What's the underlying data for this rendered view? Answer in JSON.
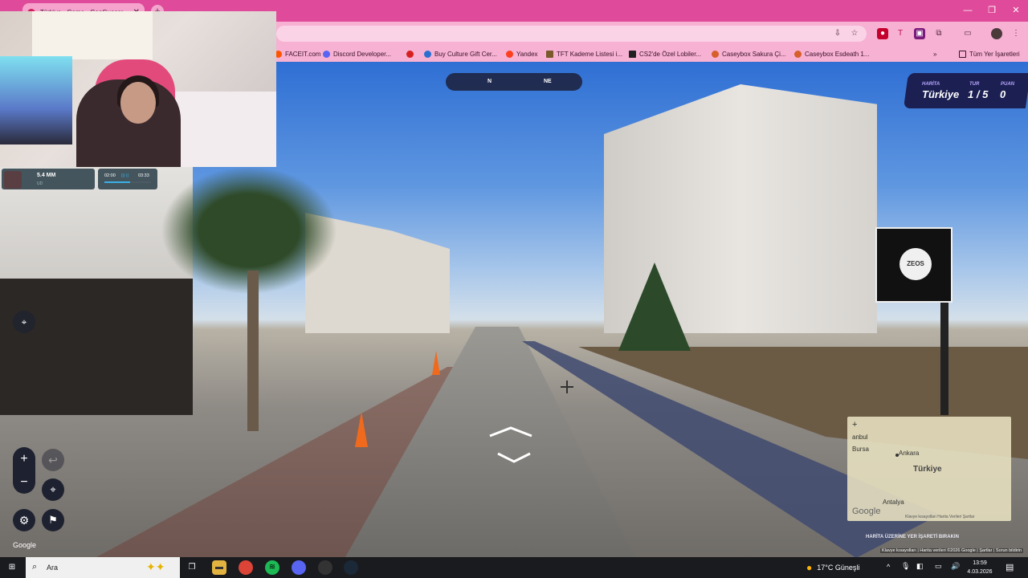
{
  "browser": {
    "tab_title": "Türkiye - Game - GeoGuessr",
    "new_tab_label": "+",
    "window_controls": [
      "—",
      "❐",
      "✕"
    ],
    "bookmarks": [
      {
        "label": "FACEIT.com",
        "color": "#ff5500"
      },
      {
        "label": "Discord Developer...",
        "color": "#5865f2"
      },
      {
        "label": "",
        "color": "#d62020"
      },
      {
        "label": "Buy Culture Gift Cer...",
        "color": "#2d6fd1"
      },
      {
        "label": "Yandex",
        "color": "#fc3f1d"
      },
      {
        "label": "TFT Kademe Listesi i...",
        "color": "#7a5a2a"
      },
      {
        "label": "CS2'de Özel Lobiler...",
        "color": "#222"
      },
      {
        "label": "Caseybox Sakura Çi...",
        "color": "#d65f2a"
      },
      {
        "label": "Caseybox Esdeath 1...",
        "color": "#d65f2a"
      }
    ],
    "bookmark_overflow": "»",
    "all_bookmarks": "Tüm Yer İşaretleri"
  },
  "game": {
    "compass": {
      "n": "N",
      "ne": "NE"
    },
    "hud": {
      "map_label": "HARİTA",
      "map_value": "Türkiye",
      "round_label": "TUR",
      "round_value": "1 / 5",
      "score_label": "PUAN",
      "score_value": "0"
    },
    "controls": {
      "zoom_in": "+",
      "zoom_out": "−",
      "undo": "↩"
    },
    "google_logo": "Google",
    "sign_text": "ZEOS",
    "minimap": {
      "zoom": "+",
      "labels": [
        "anbul",
        "Bursa",
        "Ankara",
        "Antalya"
      ],
      "country": "Türkiye",
      "google": "Google",
      "footer": "Klavye kısayolları   Harita Verileri   Şartlar",
      "prompt": "HARİTA ÜZERİNE YER İŞARETİ BIRAKIN"
    },
    "attribution": "Klavye kısayolları  |  Harita verileri ©2026 Google  |  Şartlar  |  Sorun bildirin"
  },
  "stream_widget": {
    "value": "5.4 MM",
    "unit": "UD",
    "time_start": "02:00",
    "time_end": "03:33",
    "progress": 0.55
  },
  "taskbar": {
    "search_placeholder": "Ara",
    "weather": "17°C  Güneşli",
    "time": "13:59",
    "date": "4.03.2026"
  }
}
